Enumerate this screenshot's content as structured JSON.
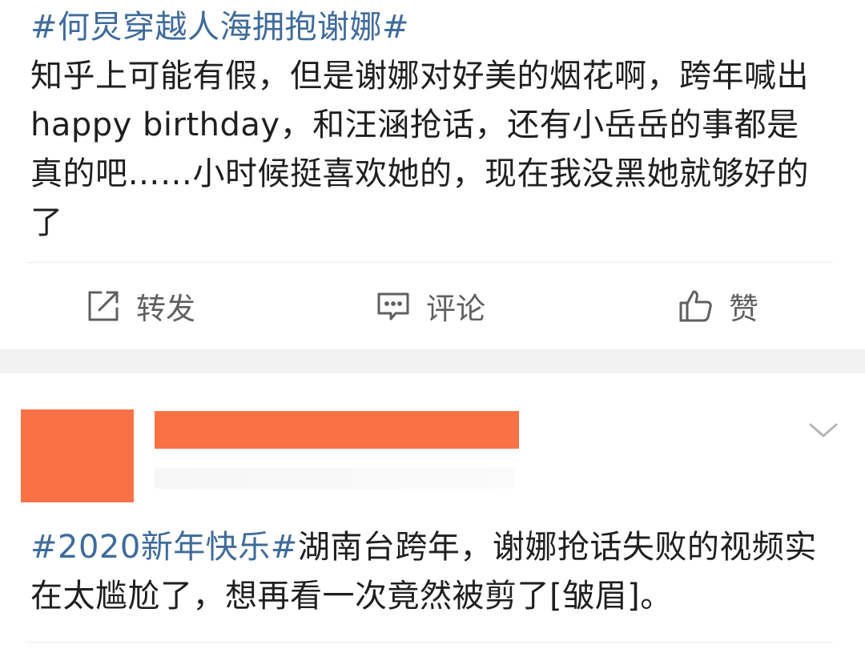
{
  "post1": {
    "hashtag": "#何炅穿越人海拥抱谢娜#",
    "body": "知乎上可能有假，但是谢娜对好美的烟花啊，跨年喊出happy birthday，和汪涵抢话，还有小岳岳的事都是真的吧……小时候挺喜欢她的，现在我没黑她就够好的了",
    "hashtag_color": "#3f6b9a"
  },
  "actions": {
    "repost": {
      "label": "转发",
      "icon": "repost-icon"
    },
    "comment": {
      "label": "评论",
      "icon": "comment-icon"
    },
    "like": {
      "label": "赞",
      "icon": "thumbs-up-icon"
    }
  },
  "post2": {
    "redaction_color": "#f97245",
    "hashtag": "#2020新年快乐#",
    "body": "湖南台跨年，谢娜抢话失败的视频实在太尴尬了，想再看一次竟然被剪了[皱眉]。",
    "menu_icon": "chevron-down-icon"
  }
}
